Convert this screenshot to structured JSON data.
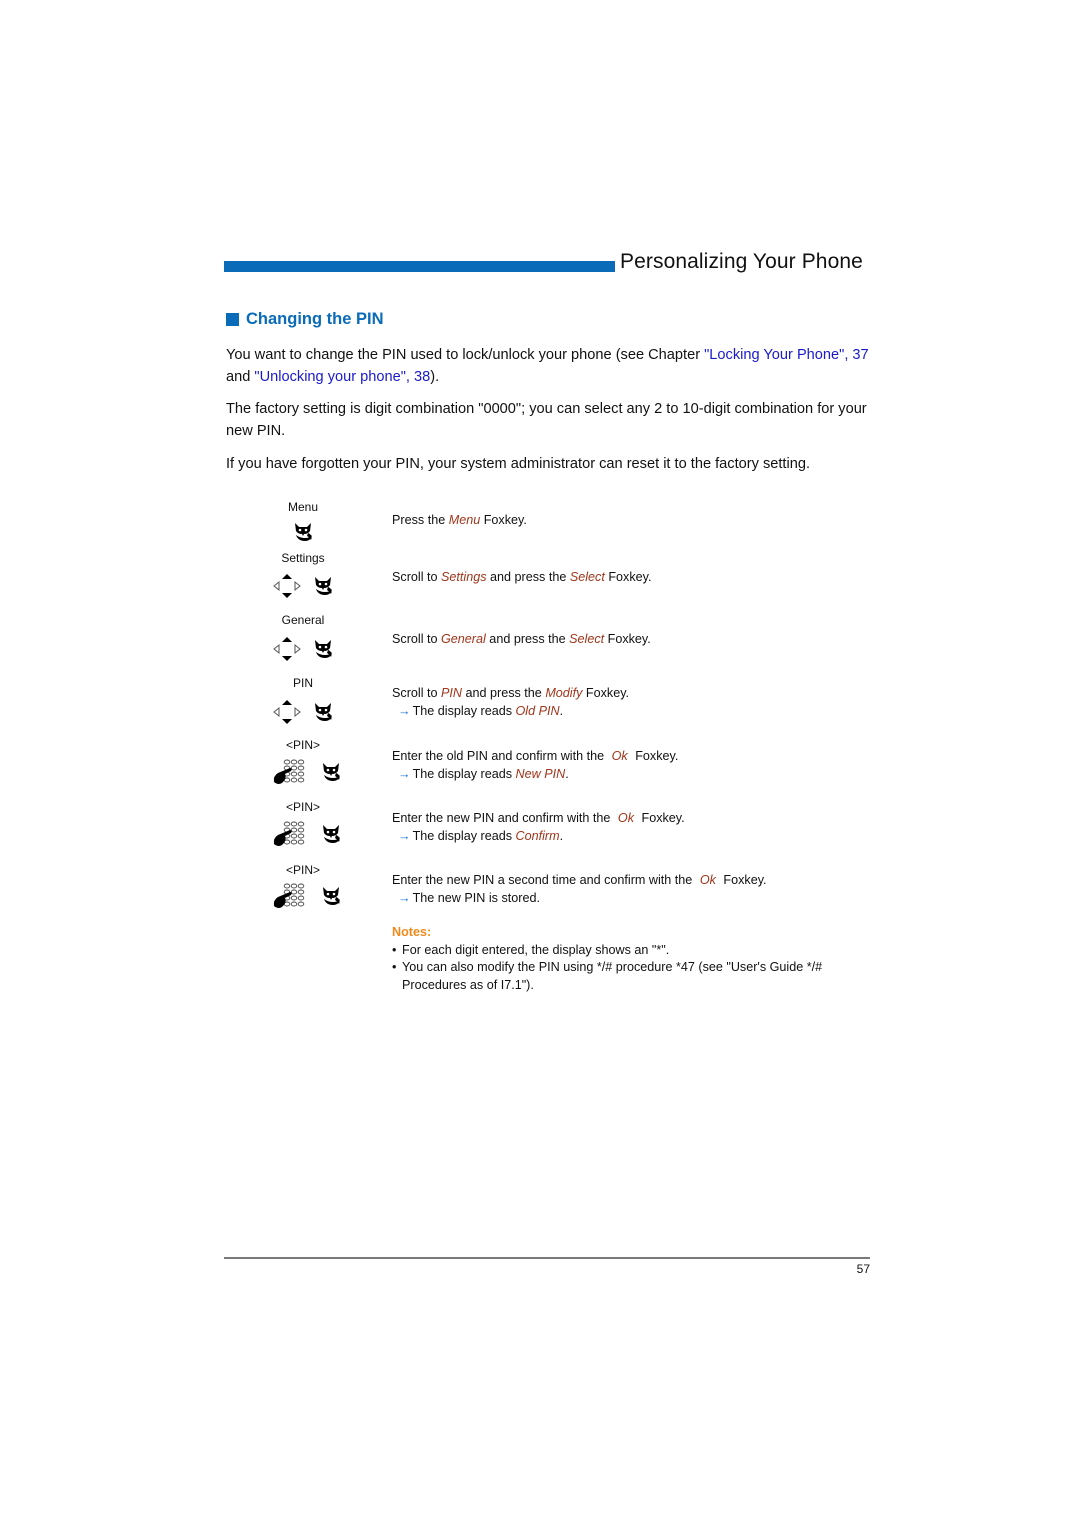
{
  "header": {
    "chapter_title": "Personalizing Your Phone",
    "accent_color": "#0a6bb8"
  },
  "section": {
    "title": "Changing the PIN"
  },
  "intro": {
    "p1_text_a": "You want to change the PIN used to lock/unlock your phone (see Chapter ",
    "p1_link1": "\"Locking Your Phone\", 37",
    "p1_text_b": " and ",
    "p1_link2": "\"Unlocking your phone\", 38",
    "p1_text_c": ").",
    "p2": "The factory setting is digit combination \"0000\"; you can select any 2 to 10-digit combination for your new PIN.",
    "p3": "If you have forgotten your PIN, your system administrator can reset it to the factory setting."
  },
  "steps": [
    {
      "display_label": "Menu",
      "icons": [
        "foxkey-icon"
      ],
      "parts": [
        "Press the ",
        "Menu",
        " Foxkey."
      ],
      "result": null
    },
    {
      "display_label": "Settings",
      "icons": [
        "navigation-keys-icon",
        "foxkey-icon"
      ],
      "parts": [
        "Scroll to ",
        "Settings",
        " and press the ",
        "Select",
        " Foxkey."
      ],
      "result": null
    },
    {
      "display_label": "General",
      "icons": [
        "navigation-keys-icon",
        "foxkey-icon"
      ],
      "parts": [
        "Scroll to ",
        "General",
        " and press the ",
        "Select",
        " Foxkey."
      ],
      "result": null
    },
    {
      "display_label": "PIN",
      "icons": [
        "navigation-keys-icon",
        "foxkey-icon"
      ],
      "parts": [
        "Scroll to ",
        "PIN",
        " and press the ",
        "Modify",
        " Foxkey."
      ],
      "result": [
        "The display reads ",
        "Old PIN",
        "."
      ]
    },
    {
      "display_label": "<PIN>",
      "icons": [
        "keypad-icon",
        "foxkey-icon"
      ],
      "parts": [
        "Enter the old PIN and confirm with the ",
        "Ok",
        " Foxkey."
      ],
      "result": [
        "The display reads ",
        "New PIN",
        "."
      ]
    },
    {
      "display_label": "<PIN>",
      "icons": [
        "keypad-icon",
        "foxkey-icon"
      ],
      "parts": [
        "Enter the new PIN and confirm with the ",
        "Ok",
        " Foxkey."
      ],
      "result": [
        "The display reads ",
        "Confirm",
        "."
      ]
    },
    {
      "display_label": "<PIN>",
      "icons": [
        "keypad-icon",
        "foxkey-icon"
      ],
      "parts": [
        "Enter the new PIN a second time and confirm with the ",
        "Ok",
        " Foxkey."
      ],
      "result": [
        "The new PIN is stored.",
        "",
        ""
      ]
    }
  ],
  "notes": {
    "heading": "Notes:",
    "bullet": "•",
    "items": [
      "For each digit entered, the display shows an \"*\".",
      "You can also modify the PIN using */# procedure *47 (see \"User's Guide */# Procedures as of I7.1\")."
    ]
  },
  "arrow_glyph": "→",
  "footer": {
    "page_number": "57"
  }
}
